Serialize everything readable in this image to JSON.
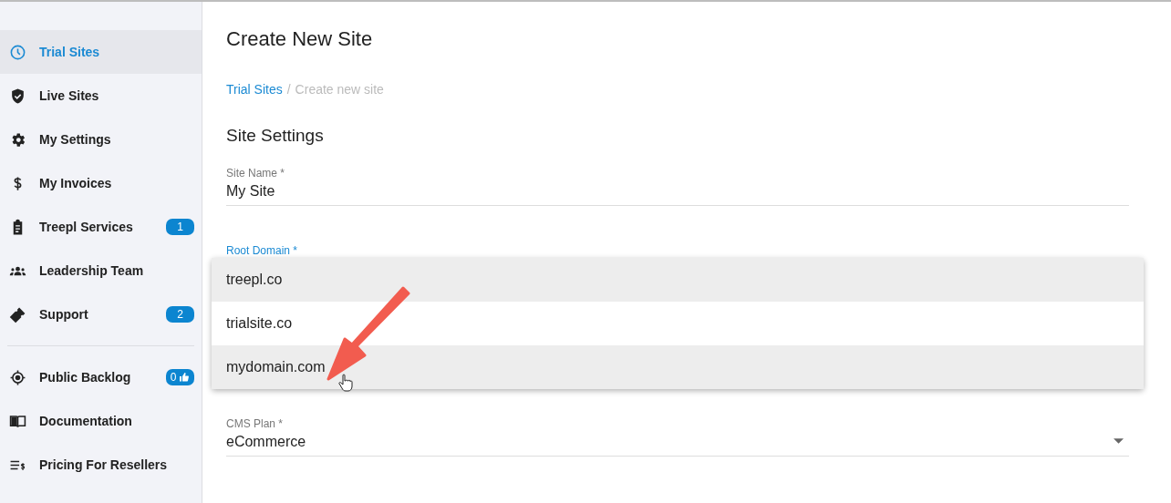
{
  "sidebar": {
    "items": [
      {
        "label": "Trial Sites",
        "selected": true
      },
      {
        "label": "Live Sites",
        "selected": false
      },
      {
        "label": "My Settings",
        "selected": false
      },
      {
        "label": "My Invoices",
        "selected": false
      },
      {
        "label": "Treepl Services",
        "selected": false,
        "badge": "1"
      },
      {
        "label": "Leadership Team",
        "selected": false
      },
      {
        "label": "Support",
        "selected": false,
        "badge": "2"
      }
    ],
    "items_2": [
      {
        "label": "Public Backlog",
        "selected": false,
        "badge": "0"
      },
      {
        "label": "Documentation",
        "selected": false
      },
      {
        "label": "Pricing For Resellers",
        "selected": false
      }
    ]
  },
  "page": {
    "title": "Create New Site",
    "breadcrumb": [
      {
        "label": "Trial Sites",
        "kind": "link"
      },
      {
        "label": "/",
        "kind": "separator"
      },
      {
        "label": "Create new site",
        "kind": "current"
      }
    ],
    "section_title": "Site Settings",
    "fields": [
      {
        "label": "Site Name *",
        "value": "My Site",
        "kind": "text"
      },
      {
        "label": "Root Domain *",
        "kind": "dropdown-open",
        "options": [
          {
            "label": "treepl.co",
            "selected": true
          },
          {
            "label": "trialsite.co",
            "selected": false
          },
          {
            "label": "mydomain.com",
            "selected": true
          }
        ]
      },
      {
        "label": "CMS Plan *",
        "value": "eCommerce",
        "kind": "select"
      }
    ]
  }
}
